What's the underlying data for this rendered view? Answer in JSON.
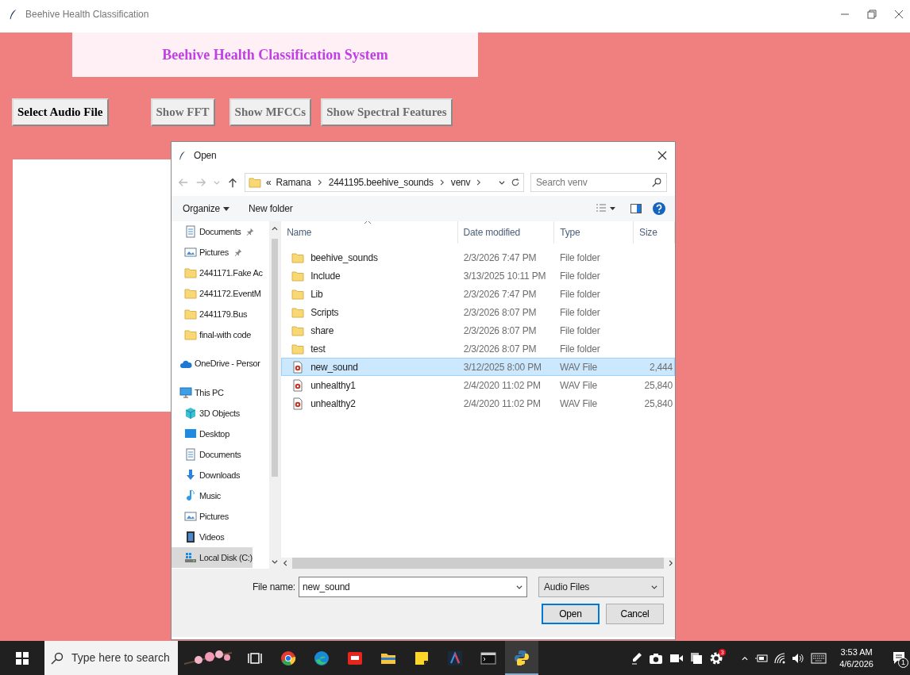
{
  "window": {
    "title": "Beehive Health Classification"
  },
  "app": {
    "banner": "Beehive Health Classification System",
    "buttons": [
      {
        "label": "Select Audio File",
        "disabled": false
      },
      {
        "label": "Show FFT",
        "disabled": true
      },
      {
        "label": "Show MFCCs",
        "disabled": true
      },
      {
        "label": "Show Spectral Features",
        "disabled": true
      }
    ]
  },
  "dialog": {
    "title": "Open",
    "address": {
      "overflow": "«",
      "crumbs": [
        "Ramana",
        "2441195.beehive_sounds",
        "venv"
      ]
    },
    "search": {
      "placeholder": "Search venv"
    },
    "toolbar": {
      "organize": "Organize",
      "new_folder": "New folder"
    },
    "nav_sections": [
      {
        "items": [
          {
            "label": "Documents",
            "kind": "document",
            "pinned": true,
            "selected": false
          },
          {
            "label": "Pictures",
            "kind": "picture",
            "pinned": true,
            "selected": false
          },
          {
            "label": "2441171.Fake Ac",
            "kind": "folder",
            "pinned": false,
            "selected": false
          },
          {
            "label": "2441172.EventM",
            "kind": "folder",
            "pinned": false,
            "selected": false
          },
          {
            "label": "2441179.Bus",
            "kind": "folder",
            "pinned": false,
            "selected": false
          },
          {
            "label": "final-with code",
            "kind": "folder",
            "pinned": false,
            "selected": false
          }
        ]
      },
      {
        "items": [
          {
            "label": "OneDrive - Persor",
            "kind": "cloud",
            "pinned": false,
            "selected": false
          }
        ]
      },
      {
        "items": [
          {
            "label": "This PC",
            "kind": "pc",
            "pinned": false,
            "selected": false,
            "children": [
              {
                "label": "3D Objects",
                "kind": "cube",
                "pinned": false,
                "selected": false
              },
              {
                "label": "Desktop",
                "kind": "desktop",
                "pinned": false,
                "selected": false
              },
              {
                "label": "Documents",
                "kind": "document",
                "pinned": false,
                "selected": false
              },
              {
                "label": "Downloads",
                "kind": "download",
                "pinned": false,
                "selected": false
              },
              {
                "label": "Music",
                "kind": "music",
                "pinned": false,
                "selected": false
              },
              {
                "label": "Pictures",
                "kind": "picture",
                "pinned": false,
                "selected": false
              },
              {
                "label": "Videos",
                "kind": "video",
                "pinned": false,
                "selected": false
              },
              {
                "label": "Local Disk (C:)",
                "kind": "disk",
                "pinned": false,
                "selected": true
              }
            ]
          }
        ]
      }
    ],
    "columns": [
      "Name",
      "Date modified",
      "Type",
      "Size"
    ],
    "files": [
      {
        "kind": "folder",
        "name": "beehive_sounds",
        "date": "2/3/2026 7:47 PM",
        "type": "File folder",
        "selected": false
      },
      {
        "kind": "folder",
        "name": "Include",
        "date": "3/13/2025 10:11 PM",
        "type": "File folder",
        "selected": false
      },
      {
        "kind": "folder",
        "name": "Lib",
        "date": "2/3/2026 7:47 PM",
        "type": "File folder",
        "selected": false
      },
      {
        "kind": "folder",
        "name": "Scripts",
        "date": "2/3/2026 8:07 PM",
        "type": "File folder",
        "selected": false
      },
      {
        "kind": "folder",
        "name": "share",
        "date": "2/3/2026 8:07 PM",
        "type": "File folder",
        "selected": false
      },
      {
        "kind": "folder",
        "name": "test",
        "date": "2/3/2026 8:07 PM",
        "type": "File folder",
        "selected": false
      },
      {
        "kind": "wav",
        "name": "new_sound",
        "date": "3/12/2025 8:00 PM",
        "type": "WAV File",
        "size": "2,444",
        "selected": true
      },
      {
        "kind": "wav",
        "name": "unhealthy1",
        "date": "2/4/2020 11:02 PM",
        "type": "WAV File",
        "size": "25,840",
        "selected": false
      },
      {
        "kind": "wav",
        "name": "unhealthy2",
        "date": "2/4/2020 11:02 PM",
        "type": "WAV File",
        "size": "25,840",
        "selected": false
      }
    ],
    "file_name": {
      "label": "File name:",
      "value": "new_sound"
    },
    "filter": "Audio Files",
    "buttons": [
      {
        "label": "Open",
        "default": true
      },
      {
        "label": "Cancel",
        "default": false
      }
    ]
  },
  "taskbar": {
    "search": {
      "placeholder": "Type here to search"
    },
    "apps": [
      {
        "kind": "chrome",
        "active": false
      },
      {
        "kind": "edge",
        "active": false
      },
      {
        "kind": "wps",
        "active": false
      },
      {
        "kind": "explorer",
        "active": false
      },
      {
        "kind": "sticky",
        "active": false
      },
      {
        "kind": "arrow-app",
        "active": false
      },
      {
        "kind": "terminal",
        "active": false
      },
      {
        "kind": "python",
        "active": true
      }
    ],
    "tray_badge": "3",
    "time": "3:53 AM",
    "date": "4/6/2026",
    "notifications": "1"
  }
}
